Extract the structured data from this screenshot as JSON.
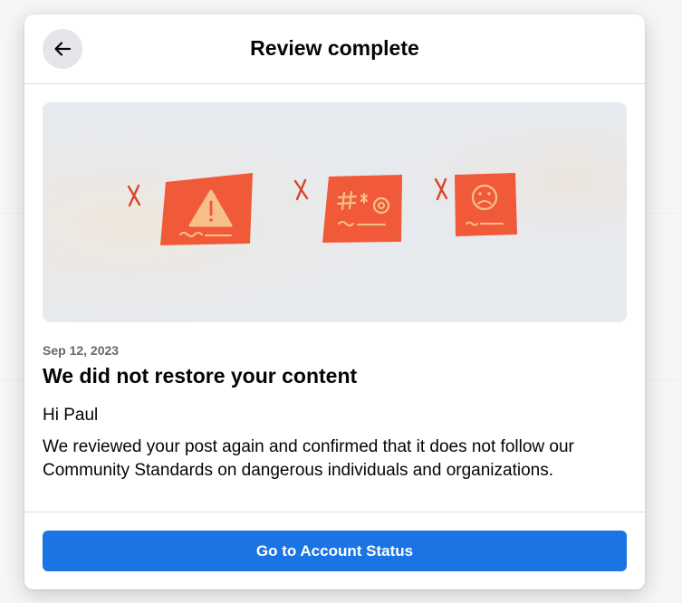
{
  "modal": {
    "title": "Review complete",
    "back_icon": "arrow-left-icon",
    "hero_icons": [
      "x-mark-icon",
      "warning-icon",
      "hate-symbol-icon",
      "sad-face-icon"
    ],
    "date": "Sep 12, 2023",
    "headline": "We did not restore your content",
    "greeting": "Hi Paul",
    "body": "We reviewed your post again and confirmed that it does not follow our Community Standards on dangerous individuals and organizations.",
    "primary_button_label": "Go to Account Status"
  },
  "colors": {
    "primary": "#1b74e4",
    "card_red": "#f05a38",
    "card_accent": "#f7c08a",
    "x_mark": "#d9452b"
  }
}
